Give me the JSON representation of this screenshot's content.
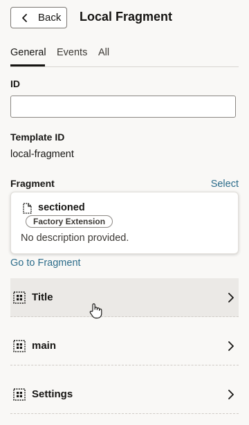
{
  "header": {
    "back_label": "Back",
    "title": "Local Fragment"
  },
  "tabs": [
    {
      "label": "General",
      "active": true
    },
    {
      "label": "Events",
      "active": false
    },
    {
      "label": "All",
      "active": false
    }
  ],
  "fields": {
    "id_label": "ID",
    "id_value": "",
    "template_id_label": "Template ID",
    "template_id_value": "local-fragment",
    "fragment_label": "Fragment",
    "select_label": "Select"
  },
  "fragment_card": {
    "icon": "document-icon",
    "name": "sectioned",
    "badge": "Factory Extension",
    "description": "No description provided."
  },
  "goto_label": "Go to Fragment",
  "rows": [
    {
      "label": "Title",
      "icon": "slot-grid-icon",
      "hovered": true
    },
    {
      "label": "main",
      "icon": "slot-grid-icon",
      "hovered": false
    },
    {
      "label": "Settings",
      "icon": "slot-grid-icon",
      "hovered": false
    }
  ],
  "colors": {
    "accent_link": "#2c6c8a",
    "background": "#f9f8f6",
    "hover_row": "#ebe9e6"
  }
}
